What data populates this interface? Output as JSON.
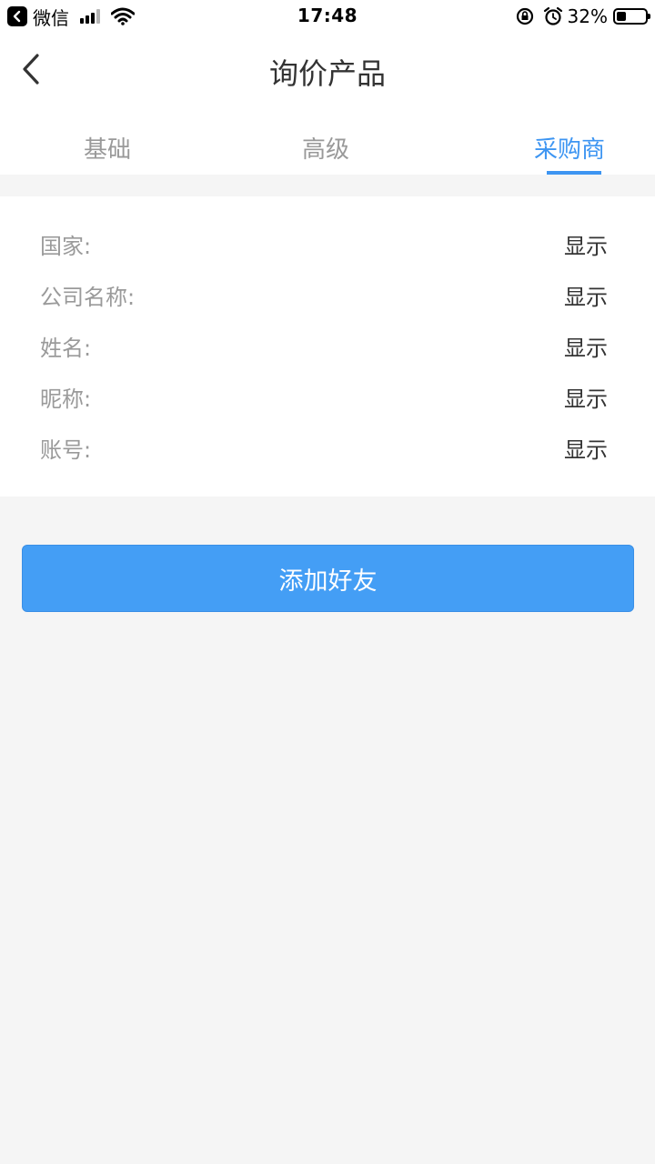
{
  "status_bar": {
    "app": "微信",
    "time": "17:48",
    "battery": "32%",
    "battery_level": 0.32
  },
  "nav": {
    "title": "询价产品",
    "back_icon": "chevron-left-icon"
  },
  "tabs": [
    {
      "label": "基础",
      "active": false
    },
    {
      "label": "高级",
      "active": false
    },
    {
      "label": "采购商",
      "active": true
    }
  ],
  "fields": [
    {
      "label": "国家:",
      "value": "显示"
    },
    {
      "label": "公司名称:",
      "value": "显示"
    },
    {
      "label": "姓名:",
      "value": "显示"
    },
    {
      "label": "昵称:",
      "value": "显示"
    },
    {
      "label": "账号:",
      "value": "显示"
    }
  ],
  "add_friend_label": "添加好友",
  "colors": {
    "accent": "#3d95f2",
    "button": "#449ef5",
    "background": "#f5f5f5"
  }
}
